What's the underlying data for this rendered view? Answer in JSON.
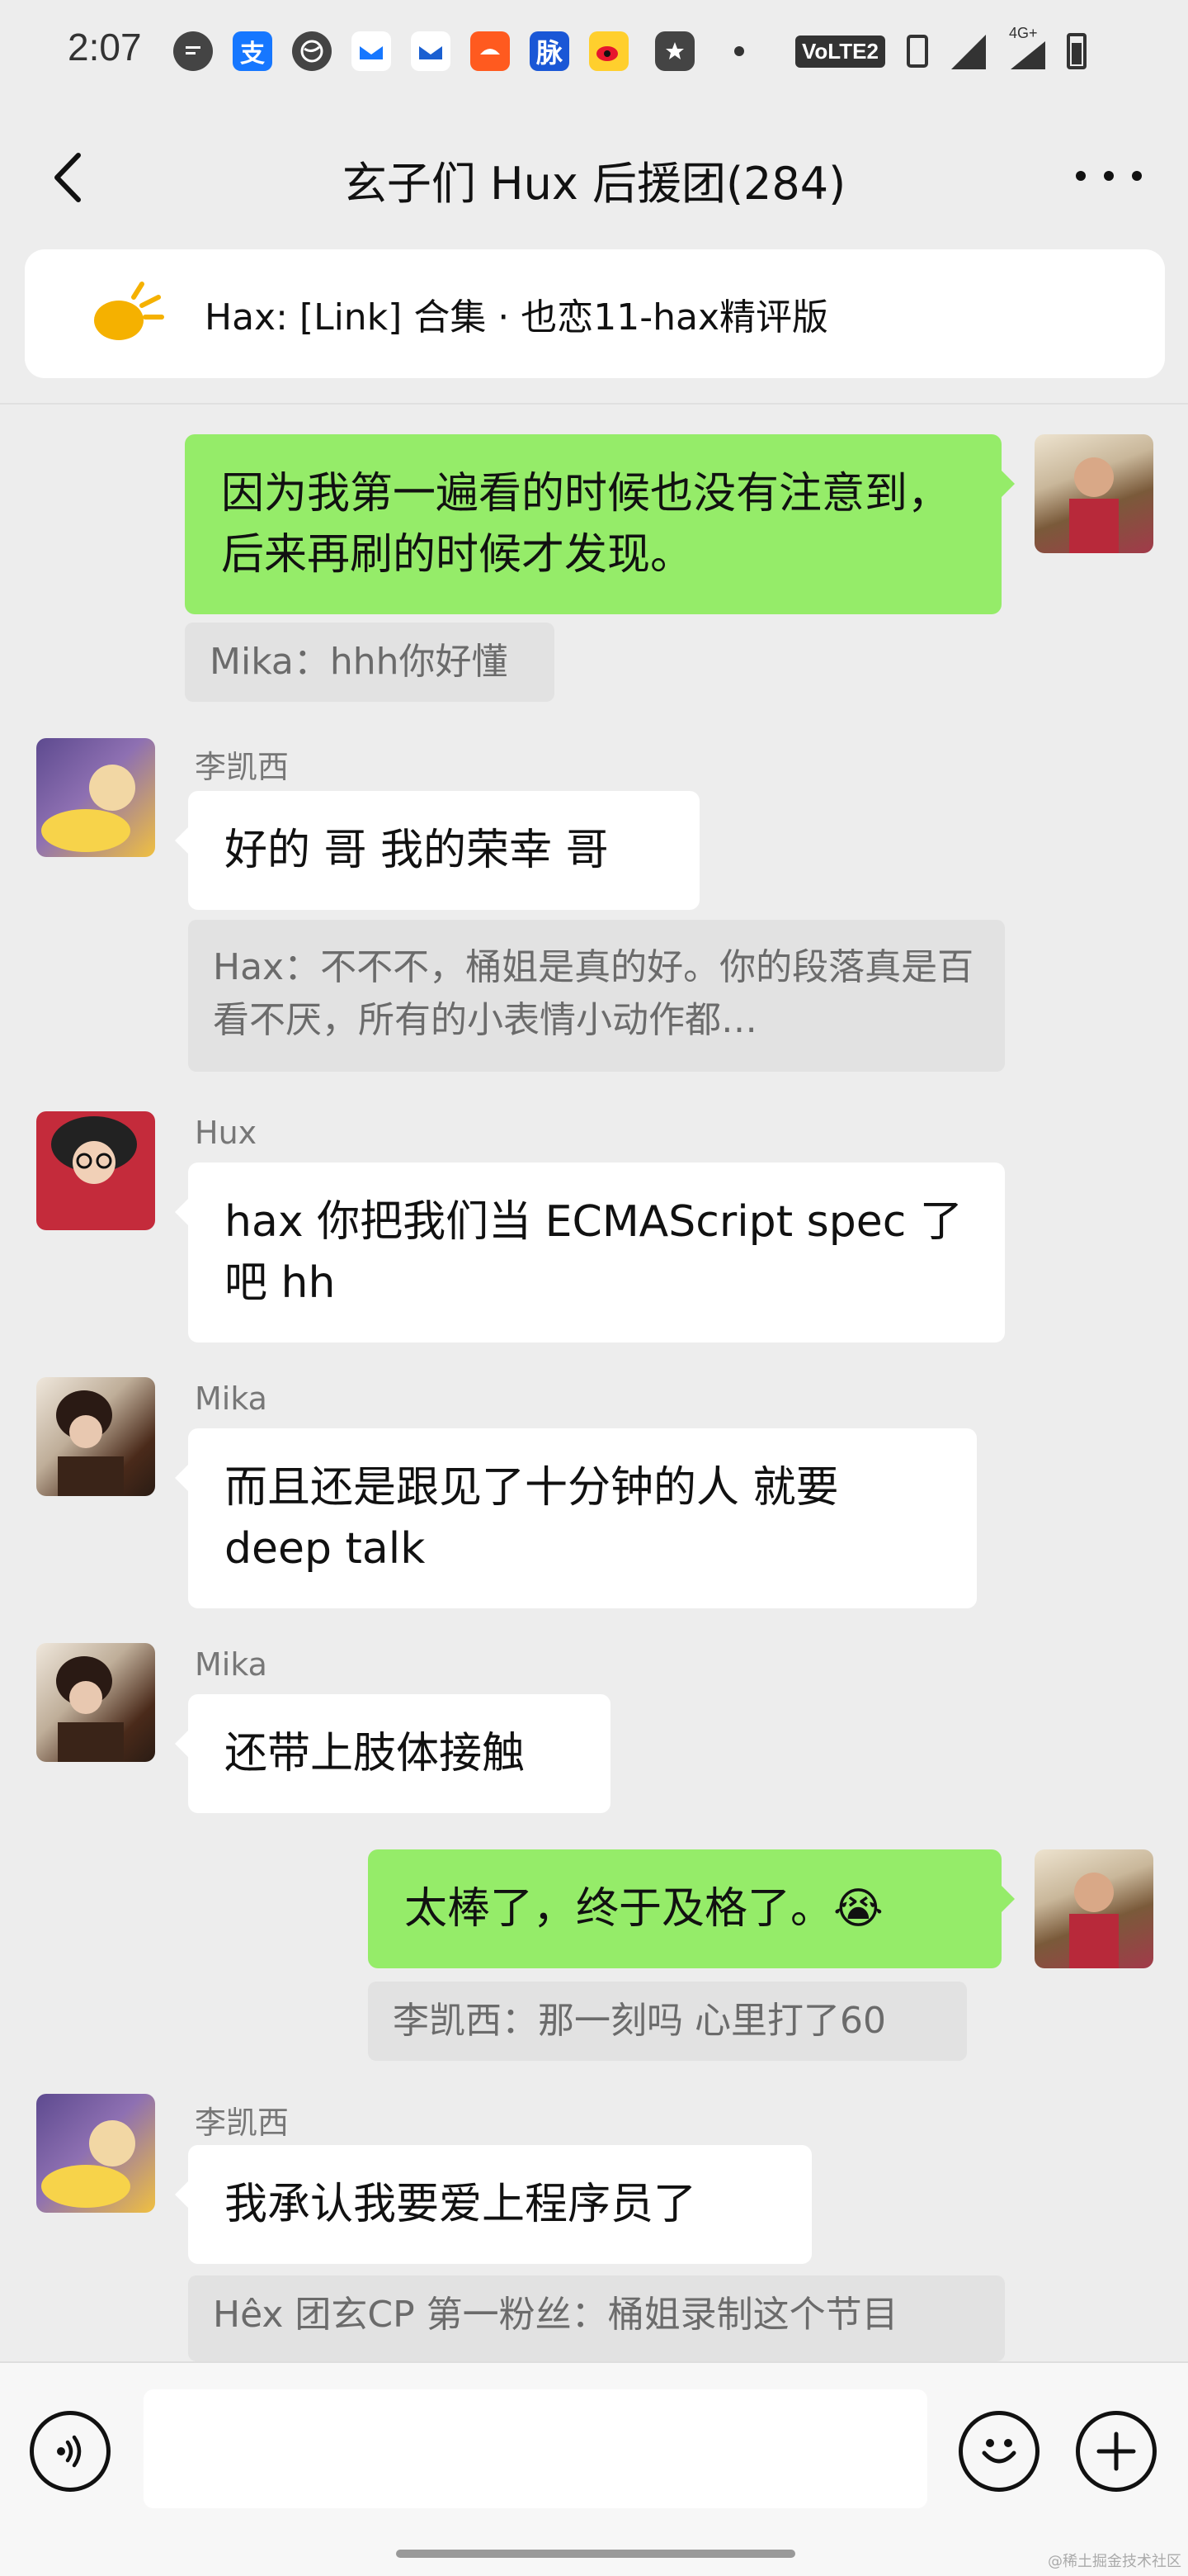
{
  "status_bar": {
    "time": "2:07",
    "icons": [
      "message-icon",
      "alipay-icon",
      "browser-icon",
      "app-icon",
      "app-icon",
      "shop-icon",
      "mai-icon",
      "weibo-icon",
      "app-icon",
      "dot-icon"
    ],
    "network_label": "VoLTE2",
    "signal_label": "4G+"
  },
  "nav": {
    "title": "玄子们 Hux 后援团(284)"
  },
  "pinned": {
    "text": "Hax: [Link] 合集 · 也恋11-hax精评版"
  },
  "messages": [
    {
      "dir": "out",
      "text": "因为我第一遍看的时候也没有注意到，后来再刷的时候才发现。",
      "quote": "Mika：hhh你好懂"
    },
    {
      "dir": "in",
      "sender": "李凯西",
      "text": "好的 哥 我的荣幸 哥",
      "quote": "Hax：不不不，桶姐是真的好。你的段落真是百看不厌，所有的小表情小动作都…"
    },
    {
      "dir": "in",
      "sender": "Hux",
      "text": "hax 你把我们当 ECMAScript spec 了吧 hh"
    },
    {
      "dir": "in",
      "sender": "Mika",
      "text": "而且还是跟见了十分钟的人 就要 deep talk"
    },
    {
      "dir": "in",
      "sender": "Mika",
      "text": "还带上肢体接触"
    },
    {
      "dir": "out",
      "text": "太棒了，终于及格了。😭",
      "quote": "李凯西：那一刻吗 心里打了60"
    },
    {
      "dir": "in",
      "sender": "李凯西",
      "text": "我承认我要爱上程序员了",
      "quote": "Hêx 团玄CP 第一粉丝：桶姐录制这个节目"
    }
  ],
  "input": {
    "placeholder": ""
  },
  "watermark": "@稀土掘金技术社区",
  "colors": {
    "outgoing_bubble": "#95ec69",
    "incoming_bubble": "#ffffff",
    "background": "#ededed",
    "quote_bg": "#e2e2e2"
  }
}
